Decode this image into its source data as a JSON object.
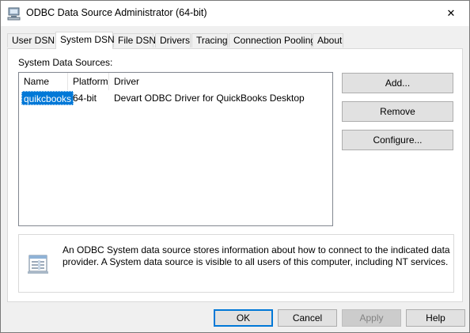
{
  "window": {
    "title": "ODBC Data Source Administrator (64-bit)",
    "close_glyph": "✕"
  },
  "tabs": [
    {
      "label": "User DSN",
      "active": false
    },
    {
      "label": "System DSN",
      "active": true
    },
    {
      "label": "File DSN",
      "active": false
    },
    {
      "label": "Drivers",
      "active": false
    },
    {
      "label": "Tracing",
      "active": false
    },
    {
      "label": "Connection Pooling",
      "active": false
    },
    {
      "label": "About",
      "active": false
    }
  ],
  "panel": {
    "section_label": "System Data Sources:",
    "columns": [
      "Name",
      "Platform",
      "Driver"
    ],
    "rows": [
      {
        "name": "quikcbooks",
        "platform": "64-bit",
        "driver": "Devart ODBC Driver for QuickBooks Desktop",
        "selected": true
      }
    ],
    "buttons": {
      "add": "Add...",
      "remove": "Remove",
      "configure": "Configure..."
    },
    "info_text": "An ODBC System data source stores information about how to connect to the indicated data provider. A System data source is visible to all users of this computer, including NT services."
  },
  "footer": {
    "ok": "OK",
    "cancel": "Cancel",
    "apply": "Apply",
    "help": "Help"
  },
  "colors": {
    "selection": "#0078d7",
    "default_button_border": "#0078d7"
  },
  "icons": {
    "title": "odbc-admin-icon",
    "close": "close-icon",
    "info": "data-source-info-icon"
  }
}
